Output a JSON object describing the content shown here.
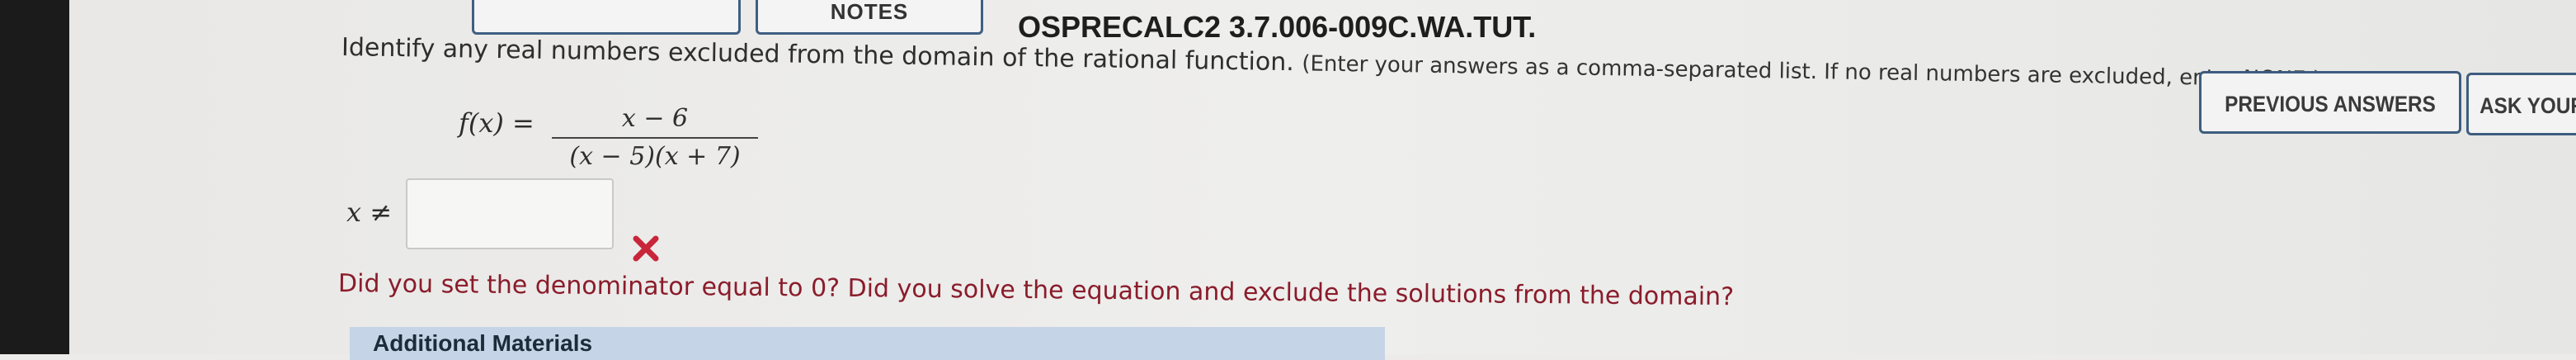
{
  "header": {
    "top_buttons": [
      "",
      "NOTES"
    ],
    "question_id": "OSPRECALC2 3.7.006-009C.WA.TUT."
  },
  "question": {
    "instruction": "Identify any real numbers excluded from the domain of the rational function.",
    "note": "(Enter your answers as a comma-separated list. If no real numbers are excluded, enter NONE.)",
    "function_label": "f(x) =",
    "numerator": "x − 6",
    "denominator": "(x − 5)(x + 7)",
    "answer_label": "x ≠",
    "answer_value": ""
  },
  "feedback": {
    "status": "incorrect",
    "message": "Did you set the denominator equal to 0? Did you solve the equation and exclude the solutions from the domain?"
  },
  "materials": {
    "title": "Additional Materials"
  },
  "side_buttons": {
    "previous": "PREVIOUS ANSWERS",
    "ask": "ASK YOUR"
  },
  "colors": {
    "feedback_text": "#8a1c2b",
    "wrong_mark": "#c8263a",
    "button_border": "#3d5d7f",
    "materials_bar": "#c5d4e6"
  },
  "icons": {
    "wrong_mark": "x-mark-icon"
  }
}
